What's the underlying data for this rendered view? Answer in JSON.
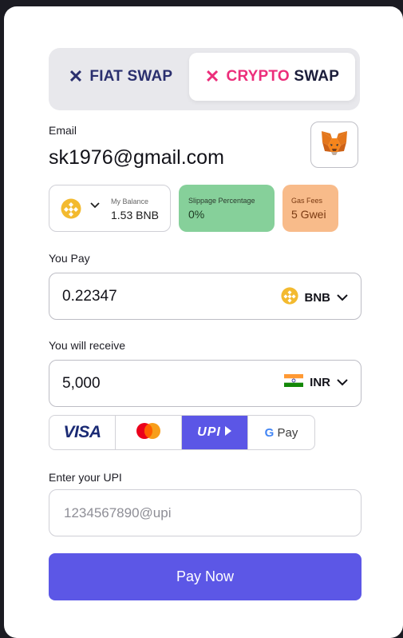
{
  "tabs": {
    "fiat": {
      "word1": "FIAT",
      "word2": "SWAP"
    },
    "crypto": {
      "word1": "CRYPTO",
      "word2": "SWAP"
    }
  },
  "email": {
    "label": "Email",
    "value": "sk1976@gmail.com"
  },
  "wallet": {
    "icon": "metamask-fox-icon"
  },
  "balance": {
    "title": "My Balance",
    "value": "1.53 BNB",
    "icon": "bnb-coin-icon"
  },
  "slippage": {
    "title": "Slippage Percentage",
    "value": "0%",
    "color": "#86d09a"
  },
  "gas": {
    "title": "Gas Fees",
    "value": "5 Gwei",
    "color": "#f8bb8a"
  },
  "you_pay": {
    "label": "You Pay",
    "amount": "0.22347",
    "currency": "BNB"
  },
  "you_receive": {
    "label": "You will receive",
    "amount": "5,000",
    "currency": "INR"
  },
  "payment_methods": {
    "visa": "VISA",
    "mastercard": "mastercard-logo",
    "upi": "UPI",
    "gpay_g": "G",
    "gpay_rest": "Pay"
  },
  "upi": {
    "label": "Enter your UPI",
    "placeholder": "1234567890@upi"
  },
  "submit": {
    "label": "Pay Now"
  },
  "colors": {
    "accent": "#5c57e6",
    "crypto_pink": "#ec2e7b"
  }
}
